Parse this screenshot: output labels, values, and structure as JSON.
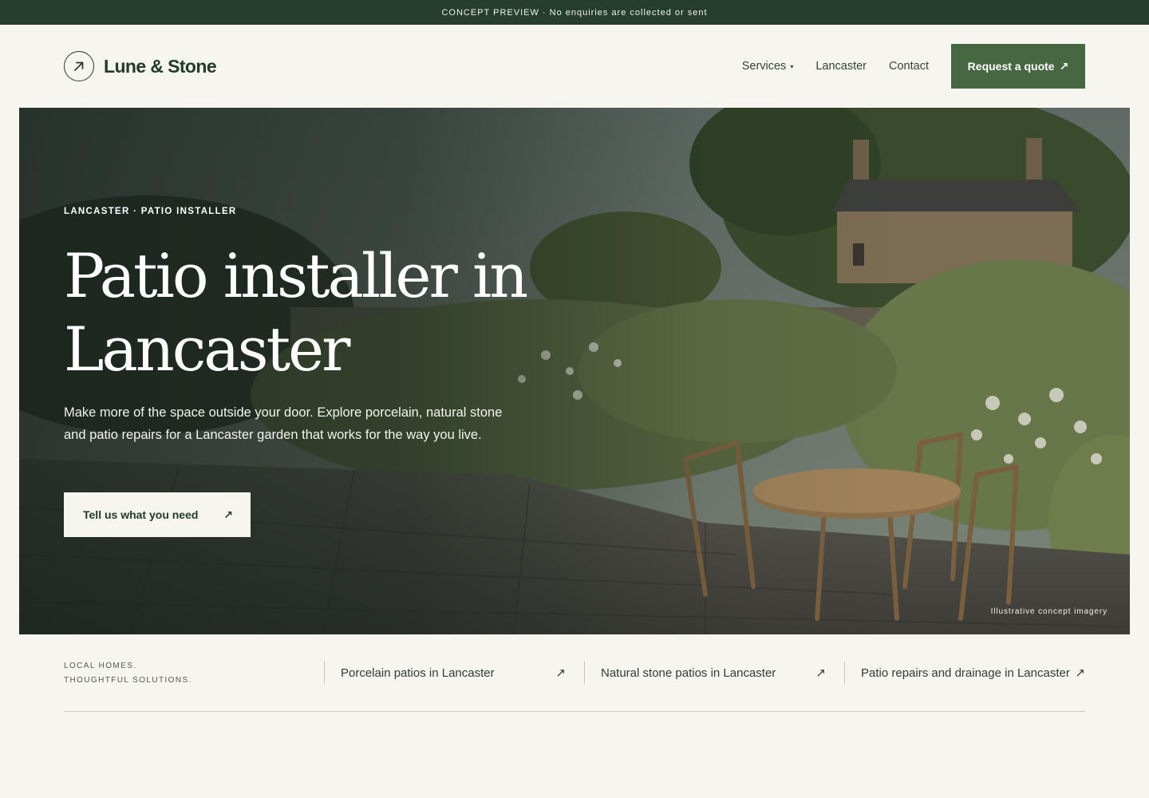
{
  "announcement": "CONCEPT PREVIEW · No enquiries are collected or sent",
  "brand": {
    "name": "Lune & Stone",
    "icon": "arrow-up-right-icon"
  },
  "nav": {
    "services_label": "Services",
    "services_caret": "▾",
    "lancaster_label": "Lancaster",
    "contact_label": "Contact",
    "quote_label": "Request a quote",
    "quote_icon": "↗"
  },
  "hero": {
    "eyebrow": "LANCASTER · PATIO INSTALLER",
    "title": "Patio installer in Lancaster",
    "lede": "Make more of the space outside your door. Explore porcelain, natural stone and patio repairs for a Lancaster garden that works for the way you live.",
    "cta_label": "Tell us what you need",
    "cta_icon": "↗",
    "image_note": "Illustrative concept imagery"
  },
  "tagline": {
    "line1": "LOCAL HOMES.",
    "line2": "THOUGHTFUL SOLUTIONS."
  },
  "services": [
    {
      "label": "Porcelain patios in Lancaster",
      "icon": "↗"
    },
    {
      "label": "Natural stone patios in Lancaster",
      "icon": "↗"
    },
    {
      "label": "Patio repairs and drainage in Lancaster",
      "icon": "↗"
    }
  ],
  "colors": {
    "background": "#f6f5ef",
    "announcement_bg": "#253e2f",
    "brand_green": "#233a2d",
    "cta_green": "#456841"
  }
}
